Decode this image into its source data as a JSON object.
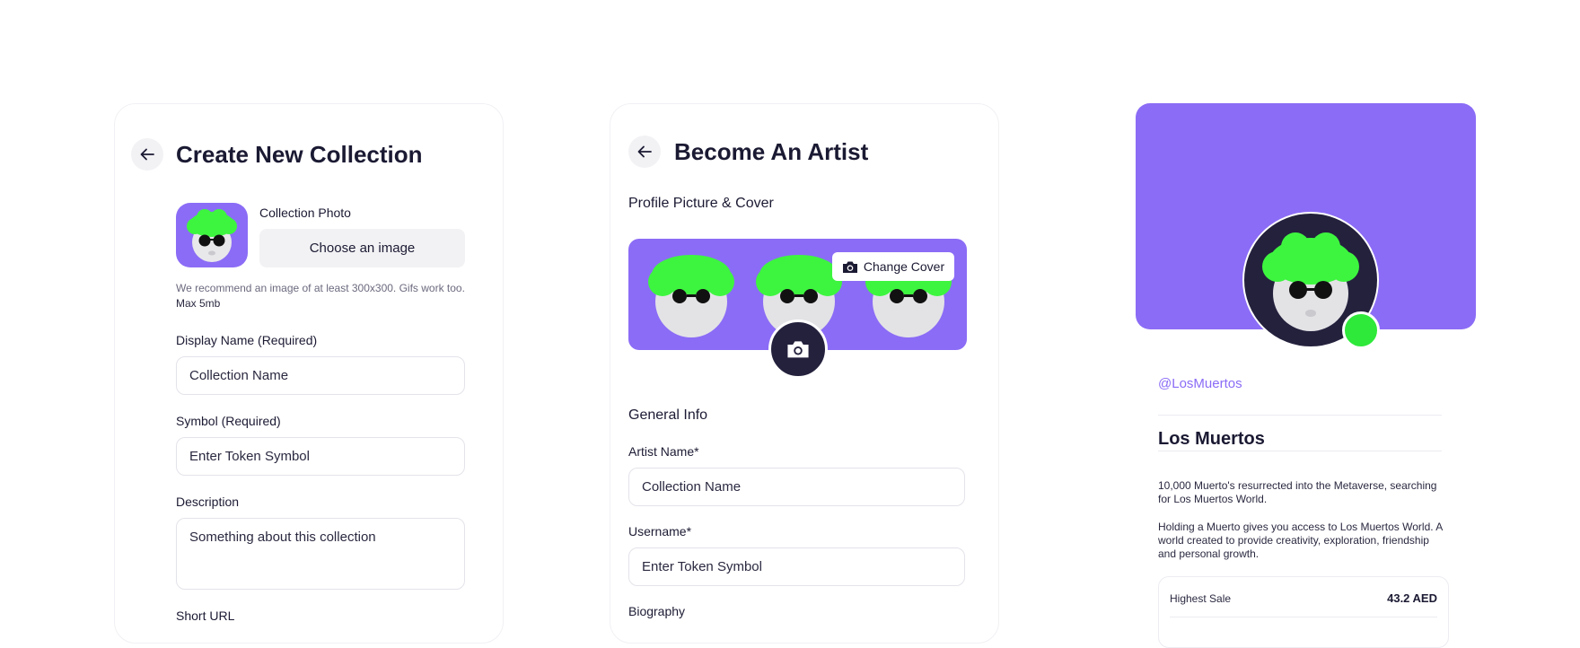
{
  "create_collection": {
    "title": "Create New Collection",
    "photo_label": "Collection Photo",
    "choose_button": "Choose an image",
    "hint_text": "We recommend an image of at least 300x300. Gifs work too.",
    "hint_max": "Max 5mb",
    "display_name_label": "Display Name (Required)",
    "display_name_value": "Collection Name",
    "symbol_label": "Symbol (Required)",
    "symbol_value": "Enter Token Symbol",
    "description_label": "Description",
    "description_value": "Something about this collection",
    "short_url_label": "Short URL"
  },
  "become_artist": {
    "title": "Become An Artist",
    "profile_section": "Profile Picture & Cover",
    "change_cover_button": "Change Cover",
    "general_info": "General Info",
    "artist_name_label": "Artist Name*",
    "artist_name_value": "Collection Name",
    "username_label": "Username*",
    "username_value": "Enter Token Symbol",
    "biography_label": "Biography"
  },
  "profile": {
    "handle": "@LosMuertos",
    "name": "Los Muertos",
    "bio_1": "10,000 Muerto's resurrected into the Metaverse, searching for Los Muertos World.",
    "bio_2": "Holding a Muerto gives you access to Los Muertos World. A world created to provide creativity, exploration, friendship and personal growth.",
    "stats": [
      {
        "label": "Highest Sale",
        "value": "43.2 AED"
      }
    ]
  },
  "colors": {
    "accent": "#8b6cf6",
    "dark": "#24213d",
    "online": "#2ee83a",
    "hair": "#3df53f"
  },
  "icons": [
    "back-arrow-icon",
    "camera-icon",
    "avatar-character"
  ]
}
